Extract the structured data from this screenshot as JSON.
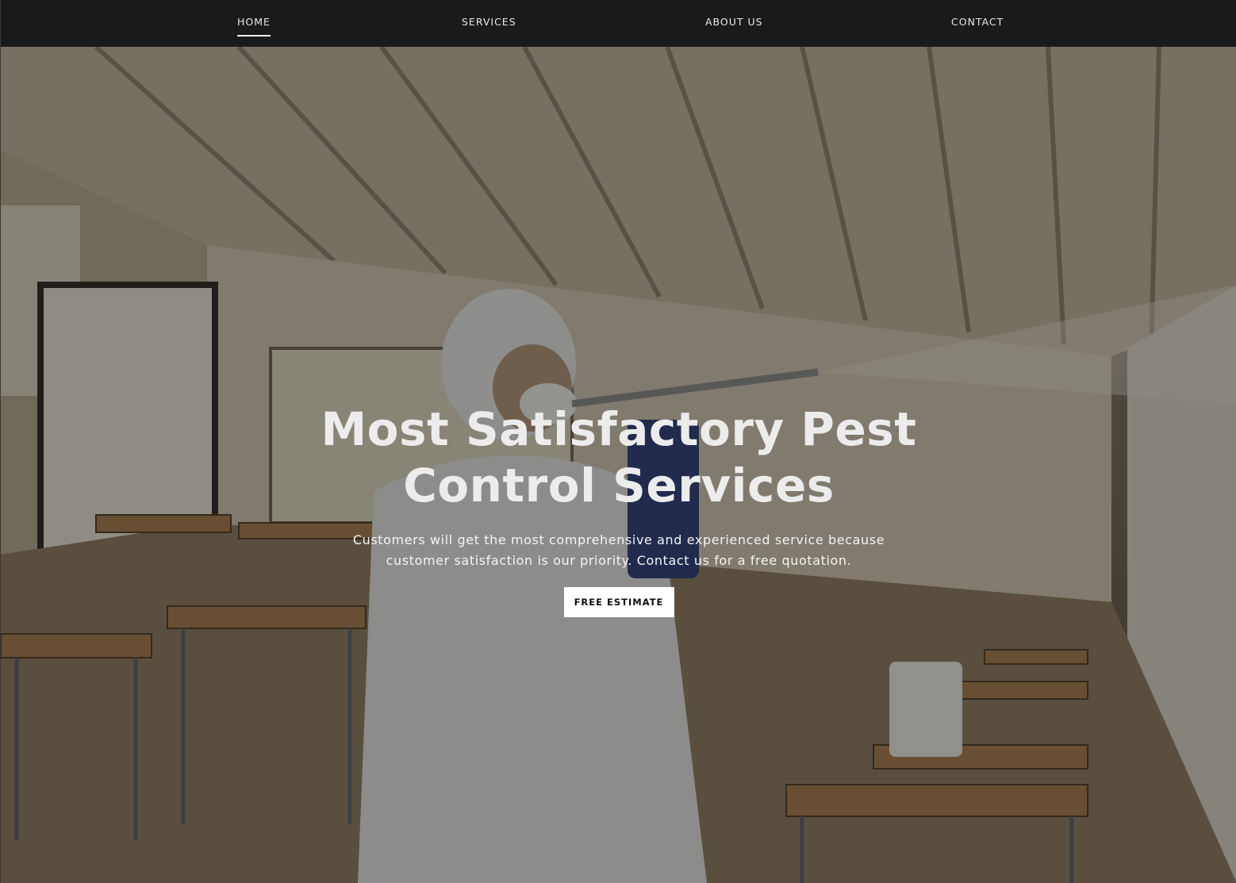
{
  "nav": {
    "items": [
      {
        "label": "HOME",
        "active": true
      },
      {
        "label": "SERVICES",
        "active": false
      },
      {
        "label": "ABOUT US",
        "active": false
      },
      {
        "label": "CONTACT",
        "active": false
      }
    ]
  },
  "hero": {
    "title": "Most Satisfactory Pest Control Services",
    "subtitle": "Customers will get the most comprehensive and experienced service because customer satisfaction is our priority. Contact us for a free quotation.",
    "cta_label": "FREE ESTIMATE",
    "background_image": "classroom-pest-disinfection-photo"
  },
  "colors": {
    "navbar_bg": "#1a1a1a",
    "nav_text": "#e8e8e8",
    "cta_bg": "#ffffff",
    "cta_text": "#111111"
  }
}
